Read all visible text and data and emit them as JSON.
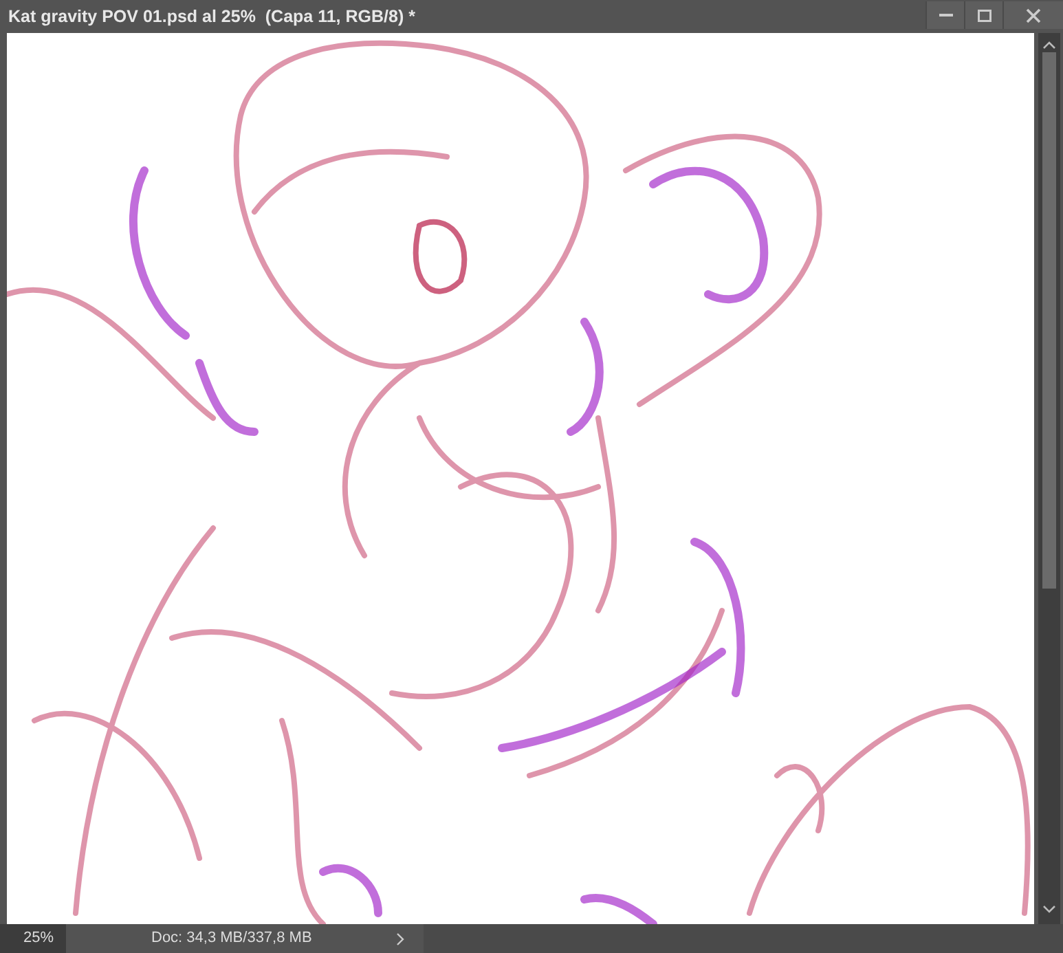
{
  "window": {
    "title": "Kat gravity POV 01.psd al 25%  (Capa 11, RGB/8) *"
  },
  "status_bar": {
    "zoom": "25%",
    "doc_info": "Doc: 34,3 MB/337,8 MB"
  }
}
